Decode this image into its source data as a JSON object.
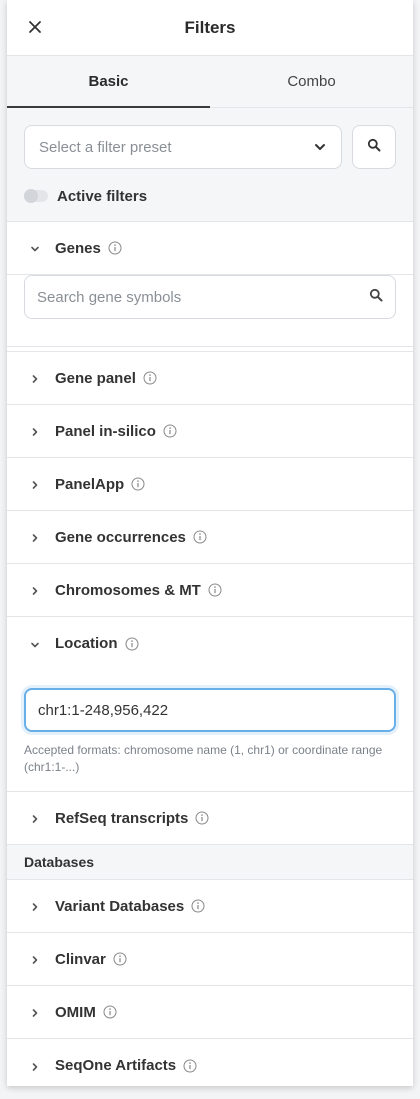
{
  "header": {
    "title": "Filters"
  },
  "tabs": [
    {
      "label": "Basic"
    },
    {
      "label": "Combo"
    }
  ],
  "preset": {
    "placeholder": "Select a filter preset"
  },
  "active_filters": {
    "label": "Active filters",
    "enabled": false
  },
  "genes": {
    "label": "Genes",
    "search_placeholder": "Search gene symbols",
    "search_value": ""
  },
  "sections_a": [
    {
      "label": "Gene panel"
    },
    {
      "label": "Panel in-silico"
    },
    {
      "label": "PanelApp"
    },
    {
      "label": "Gene occurrences"
    },
    {
      "label": "Chromosomes & MT"
    }
  ],
  "location": {
    "label": "Location",
    "value": "chr1:1-248,956,422",
    "help": "Accepted formats: chromosome name (1, chr1) or coordinate range (chr1:1-...)"
  },
  "refseq": {
    "label": "RefSeq transcripts"
  },
  "databases": {
    "header": "Databases",
    "items": [
      {
        "label": "Variant Databases"
      },
      {
        "label": "Clinvar"
      },
      {
        "label": "OMIM"
      },
      {
        "label": "SeqOne Artifacts"
      }
    ]
  },
  "colors": {
    "focus_ring": "#6aaee8",
    "panel_bg": "#f5f6f8"
  },
  "icons": {
    "close": "close-icon",
    "dropdown": "chevron-down-icon",
    "search": "search-icon",
    "info": "info-icon",
    "collapsed": "chevron-right-icon",
    "expanded": "chevron-down-icon"
  }
}
